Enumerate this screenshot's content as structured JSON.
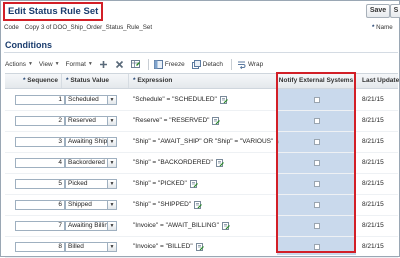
{
  "page": {
    "title": "Edit Status Rule Set",
    "save_label": "Save",
    "save_and_close_label": "S"
  },
  "header": {
    "code_label": "Code",
    "code_value": "Copy 3 of DOO_Ship_Order_Status_Rule_Set",
    "name_label": "Name",
    "required_marker": "*"
  },
  "conditions": {
    "title": "Conditions",
    "toolbar": {
      "actions": "Actions",
      "view": "View",
      "format": "Format",
      "freeze": "Freeze",
      "detach": "Detach",
      "wrap": "Wrap"
    },
    "columns": {
      "sequence": "Sequence",
      "status_value": "Status Value",
      "expression": "Expression",
      "notify": "Notify External Systems",
      "last_update": "Last Update"
    },
    "rows": [
      {
        "sequence": "1",
        "status": "Scheduled",
        "expression": "\"Schedule\" = \"SCHEDULED\"",
        "date": "8/21/15"
      },
      {
        "sequence": "2",
        "status": "Reserved",
        "expression": "\"Reserve\" = \"RESERVED\"",
        "date": "8/21/15"
      },
      {
        "sequence": "3",
        "status": "Awaiting Ship",
        "expression": "\"Ship\" = \"AWAIT_SHIP\" OR \"Ship\" = \"VARIOUS\"",
        "date": "8/21/15"
      },
      {
        "sequence": "4",
        "status": "Backordered",
        "expression": "\"Ship\" = \"BACKORDERED\"",
        "date": "8/21/15"
      },
      {
        "sequence": "5",
        "status": "Picked",
        "expression": "\"Ship\" = \"PICKED\"",
        "date": "8/21/15"
      },
      {
        "sequence": "6",
        "status": "Shipped",
        "expression": "\"Ship\" = \"SHIPPED\"",
        "date": "8/21/15"
      },
      {
        "sequence": "7",
        "status": "Awaiting Billing",
        "expression": "\"Invoice\" = \"AWAIT_BILLING\"",
        "date": "8/21/15"
      },
      {
        "sequence": "8",
        "status": "Billed",
        "expression": "\"Invoice\" = \"BILLED\"",
        "date": "8/21/15"
      }
    ]
  },
  "colors": {
    "title_blue": "#1b3d6e",
    "highlight_red": "#d21f27",
    "column_highlight": "#c9d9ec"
  }
}
